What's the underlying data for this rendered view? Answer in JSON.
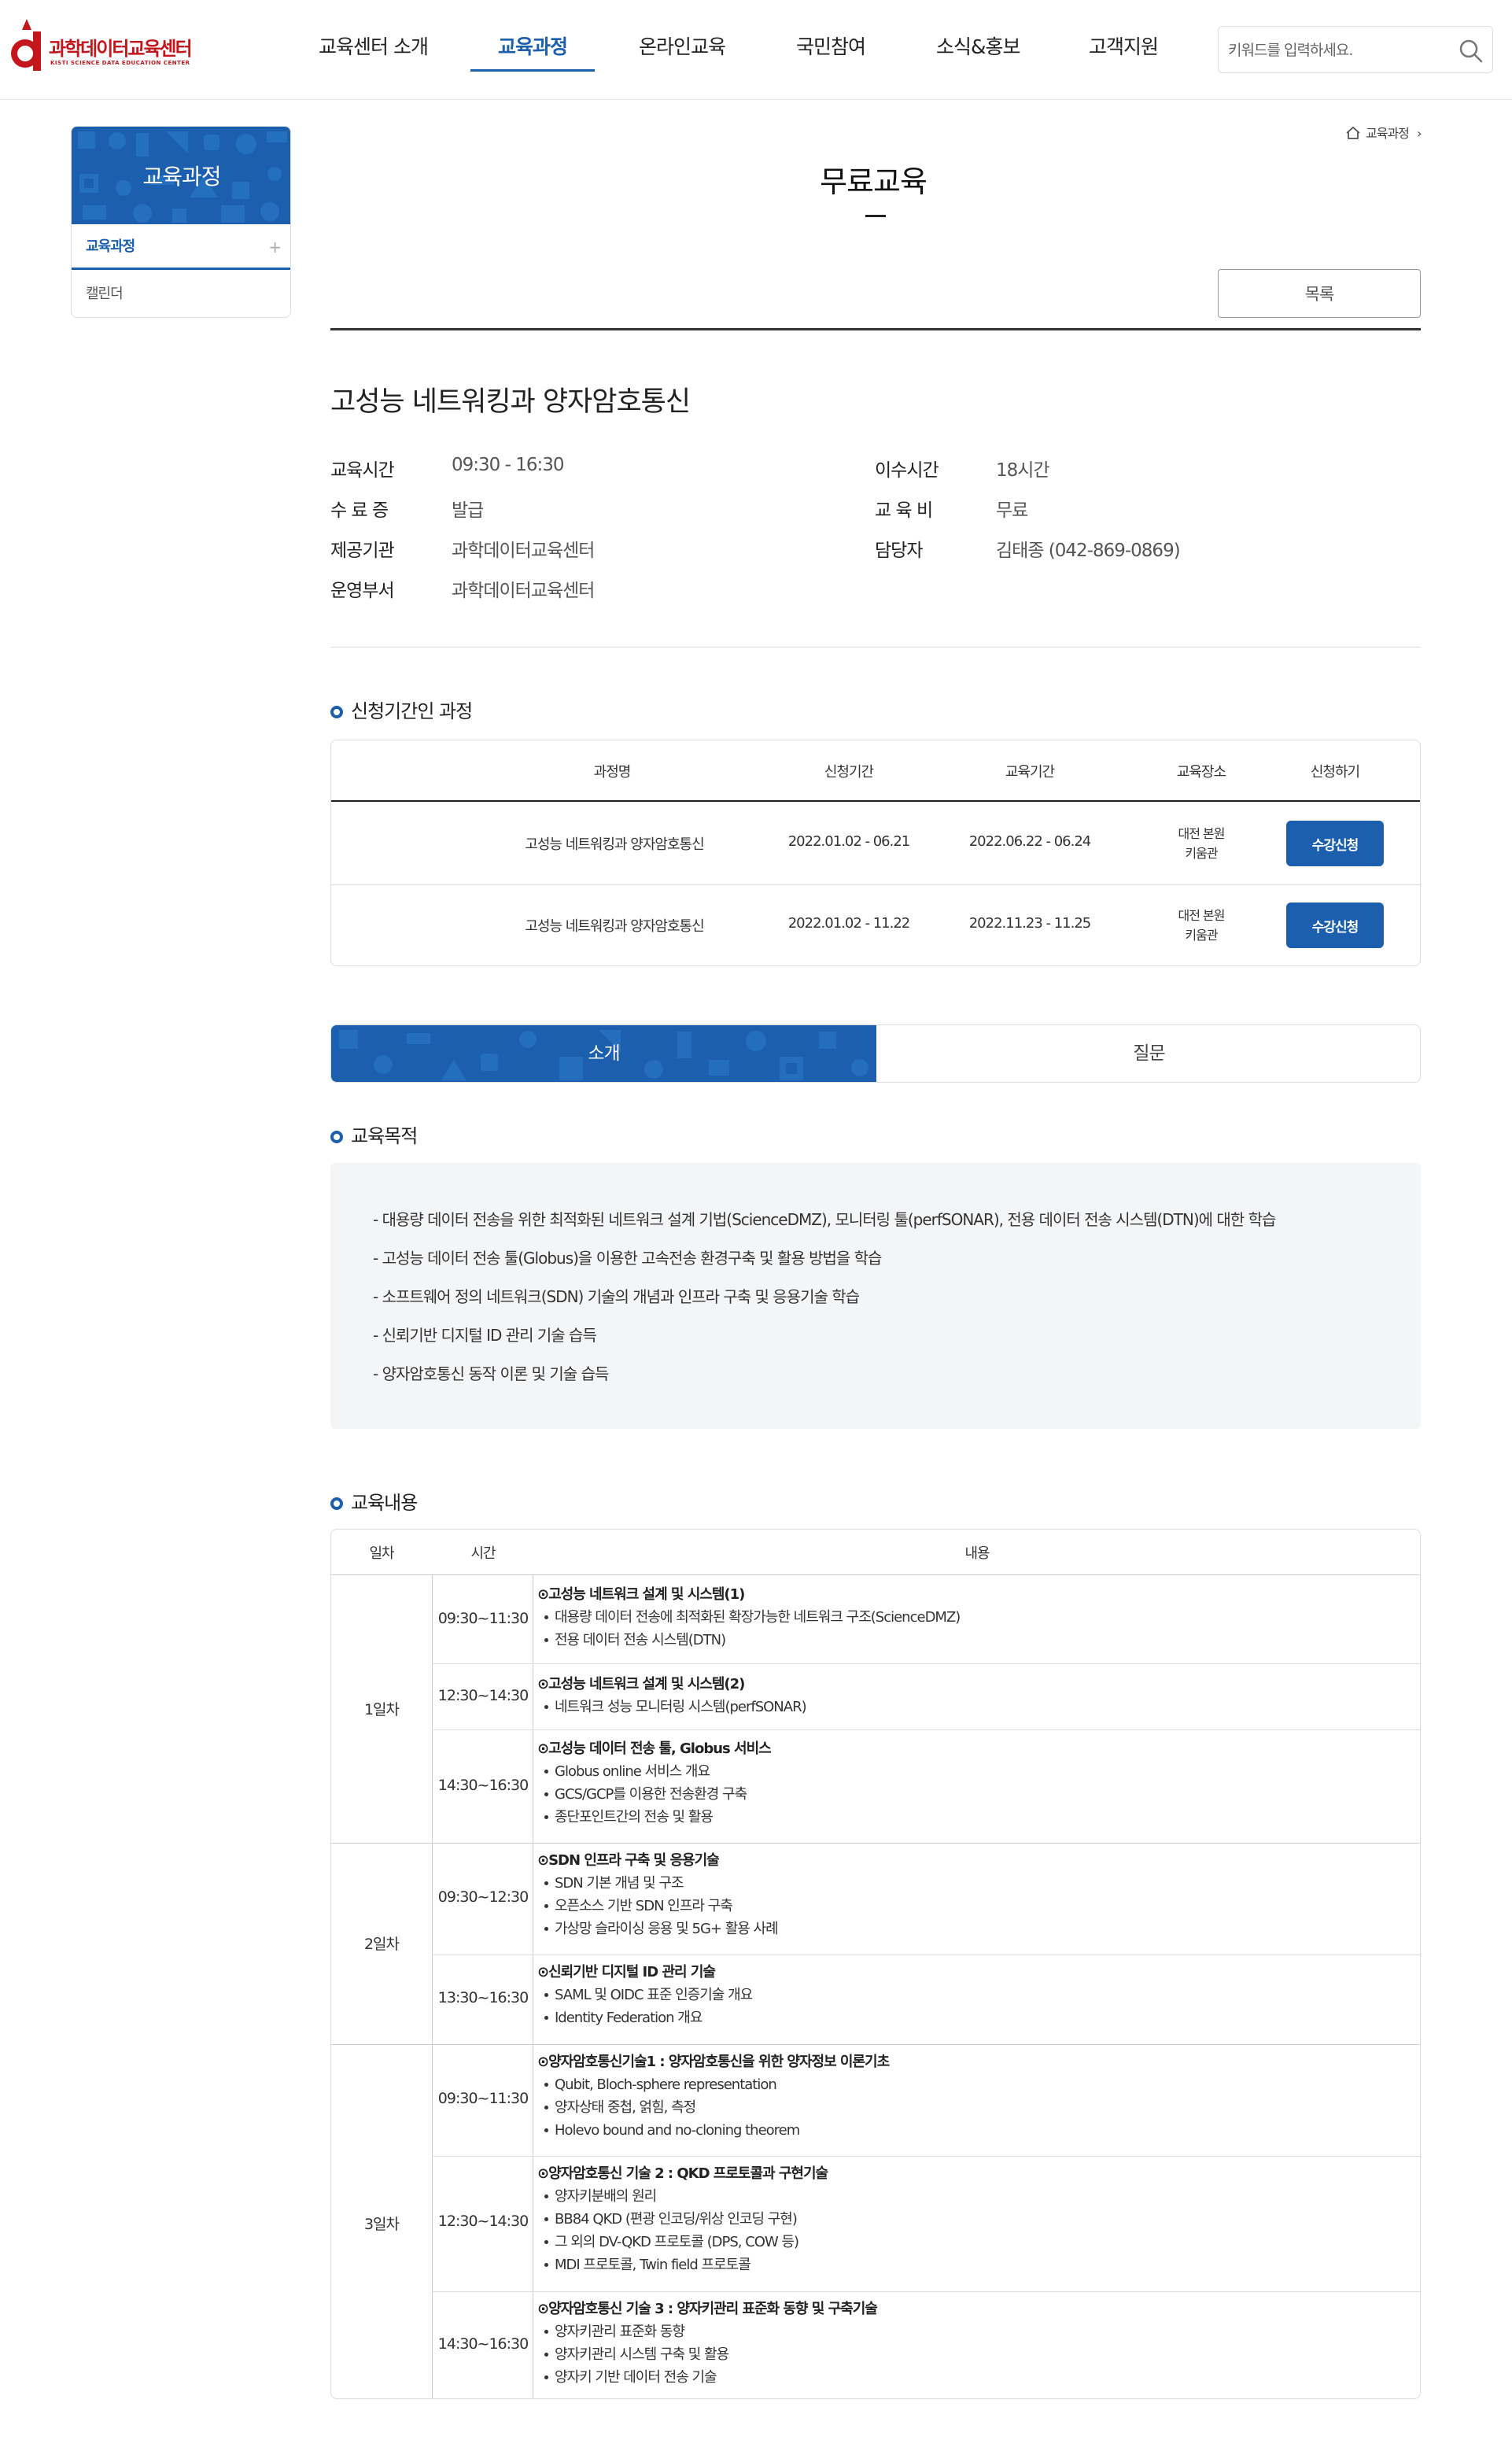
{
  "header": {
    "logo_ko": "과학데이터교육센터",
    "logo_en": "KISTI SCIENCE DATA EDUCATION CENTER",
    "nav": [
      "교육센터 소개",
      "교육과정",
      "온라인교육",
      "국민참여",
      "소식&홍보",
      "고객지원"
    ],
    "active_nav": "교육과정",
    "search_placeholder": "키워드를 입력하세요."
  },
  "sidebar": {
    "title": "교육과정",
    "items": [
      {
        "label": "교육과정",
        "plus": "+"
      },
      {
        "label": "캘린더"
      }
    ]
  },
  "breadcrumb": {
    "current": "교육과정",
    "separator": "›"
  },
  "page": {
    "title": "무료교육",
    "list_button": "목록"
  },
  "course": {
    "name": "고성능 네트워킹과 양자암호통신",
    "info": [
      {
        "label": "교육시간",
        "value": "09:30  -  16:30"
      },
      {
        "label": "수 료 증",
        "value": "발급"
      },
      {
        "label": "제공기관",
        "value": "과학데이터교육센터"
      },
      {
        "label": "운영부서",
        "value": "과학데이터교육센터"
      },
      {
        "label": "이수시간",
        "value": "18시간"
      },
      {
        "label": "교 육 비",
        "value": "무료"
      },
      {
        "label": "담당자",
        "value": "김태종 (042-869-0869)"
      }
    ]
  },
  "apply_section": {
    "title": "신청기간인 과정",
    "columns": [
      "과정명",
      "신청기간",
      "교육기간",
      "교육장소",
      "신청하기"
    ],
    "rows": [
      {
        "name": "고성능 네트워킹과 양자암호통신",
        "apply": "2022.01.02 - 06.21",
        "edu": "2022.06.22 - 06.24",
        "loc1": "대전 본원",
        "loc2": "키움관",
        "button": "수강신청"
      },
      {
        "name": "고성능 네트워킹과 양자암호통신",
        "apply": "2022.01.02 - 11.22",
        "edu": "2022.11.23 - 11.25",
        "loc1": "대전 본원",
        "loc2": "키움관",
        "button": "수강신청"
      }
    ]
  },
  "tabs": [
    "소개",
    "질문"
  ],
  "goal": {
    "title": "교육목적",
    "items": [
      "- 대용량 데이터 전송을 위한 최적화된 네트워크 설계 기법(ScienceDMZ), 모니터링 툴(perfSONAR), 전용 데이터 전송 시스템(DTN)에 대한 학습",
      "- 고성능 데이터 전송 툴(Globus)을 이용한 고속전송 환경구축 및 활용 방법을 학습",
      "- 소프트웨어 정의 네트워크(SDN) 기술의 개념과 인프라 구축 및 응용기술 학습",
      "- 신뢰기반 디지털 ID 관리 기술 습득",
      "- 양자암호통신 동작 이론 및 기술 습득"
    ]
  },
  "curriculum": {
    "title": "교육내용",
    "columns": [
      "일차",
      "시간",
      "내용"
    ],
    "days": [
      {
        "day": "1일차",
        "sessions": [
          {
            "time": "09:30~11:30",
            "title": "⊙고성능 네트워크 설계 및 시스템(1)",
            "bullets": [
              "대용량 데이터 전송에 최적화된 확장가능한 네트워크 구조(ScienceDMZ)",
              "전용 데이터 전송 시스템(DTN)"
            ]
          },
          {
            "time": "12:30~14:30",
            "title": "⊙고성능 네트워크 설계 및 시스템(2)",
            "bullets": [
              "네트워크 성능 모니터링 시스템(perfSONAR)"
            ]
          },
          {
            "time": "14:30~16:30",
            "title": "⊙고성능 데이터 전송 툴, Globus 서비스",
            "bullets": [
              "Globus online 서비스 개요",
              "GCS/GCP를 이용한 전송환경 구축",
              "종단포인트간의 전송 및 활용"
            ]
          }
        ]
      },
      {
        "day": "2일차",
        "sessions": [
          {
            "time": "09:30~12:30",
            "title": "⊙SDN 인프라 구축 및 응용기술",
            "bullets": [
              "SDN 기본 개념 및 구조",
              "오픈소스 기반 SDN 인프라 구축",
              "가상망 슬라이싱 응용 및 5G+ 활용 사례"
            ]
          },
          {
            "time": "13:30~16:30",
            "title": "⊙신뢰기반 디지털 ID 관리 기술",
            "bullets": [
              "SAML 및 OIDC 표준 인증기술 개요",
              "Identity Federation 개요"
            ]
          }
        ]
      },
      {
        "day": "3일차",
        "sessions": [
          {
            "time": "09:30~11:30",
            "title": "⊙양자암호통신기술1 : 양자암호통신을 위한 양자정보 이론기초",
            "bullets": [
              "Qubit, Bloch-sphere representation",
              "양자상태 중첩, 얽힘, 측정",
              "Holevo bound and no-cloning theorem"
            ]
          },
          {
            "time": "12:30~14:30",
            "title": "⊙양자암호통신 기술 2 : QKD 프로토콜과 구현기술",
            "bullets": [
              "양자키분배의 원리",
              "BB84 QKD (편광 인코딩/위상 인코딩 구현)",
              "그 외의 DV-QKD 프로토콜 (DPS, COW 등)",
              "MDI 프로토콜, Twin field 프로토콜"
            ]
          },
          {
            "time": "14:30~16:30",
            "title": "⊙양자암호통신 기술 3 : 양자키관리 표준화 동향 및 구축기술",
            "bullets": [
              "양자키관리 표준화 동향",
              "양자키관리 시스템 구축 및 활용",
              "양자키 기반 데이터 전송 기술"
            ]
          }
        ]
      }
    ]
  },
  "colors": {
    "brand_blue": "#1b5fae",
    "logo_red": "#c3161d"
  }
}
